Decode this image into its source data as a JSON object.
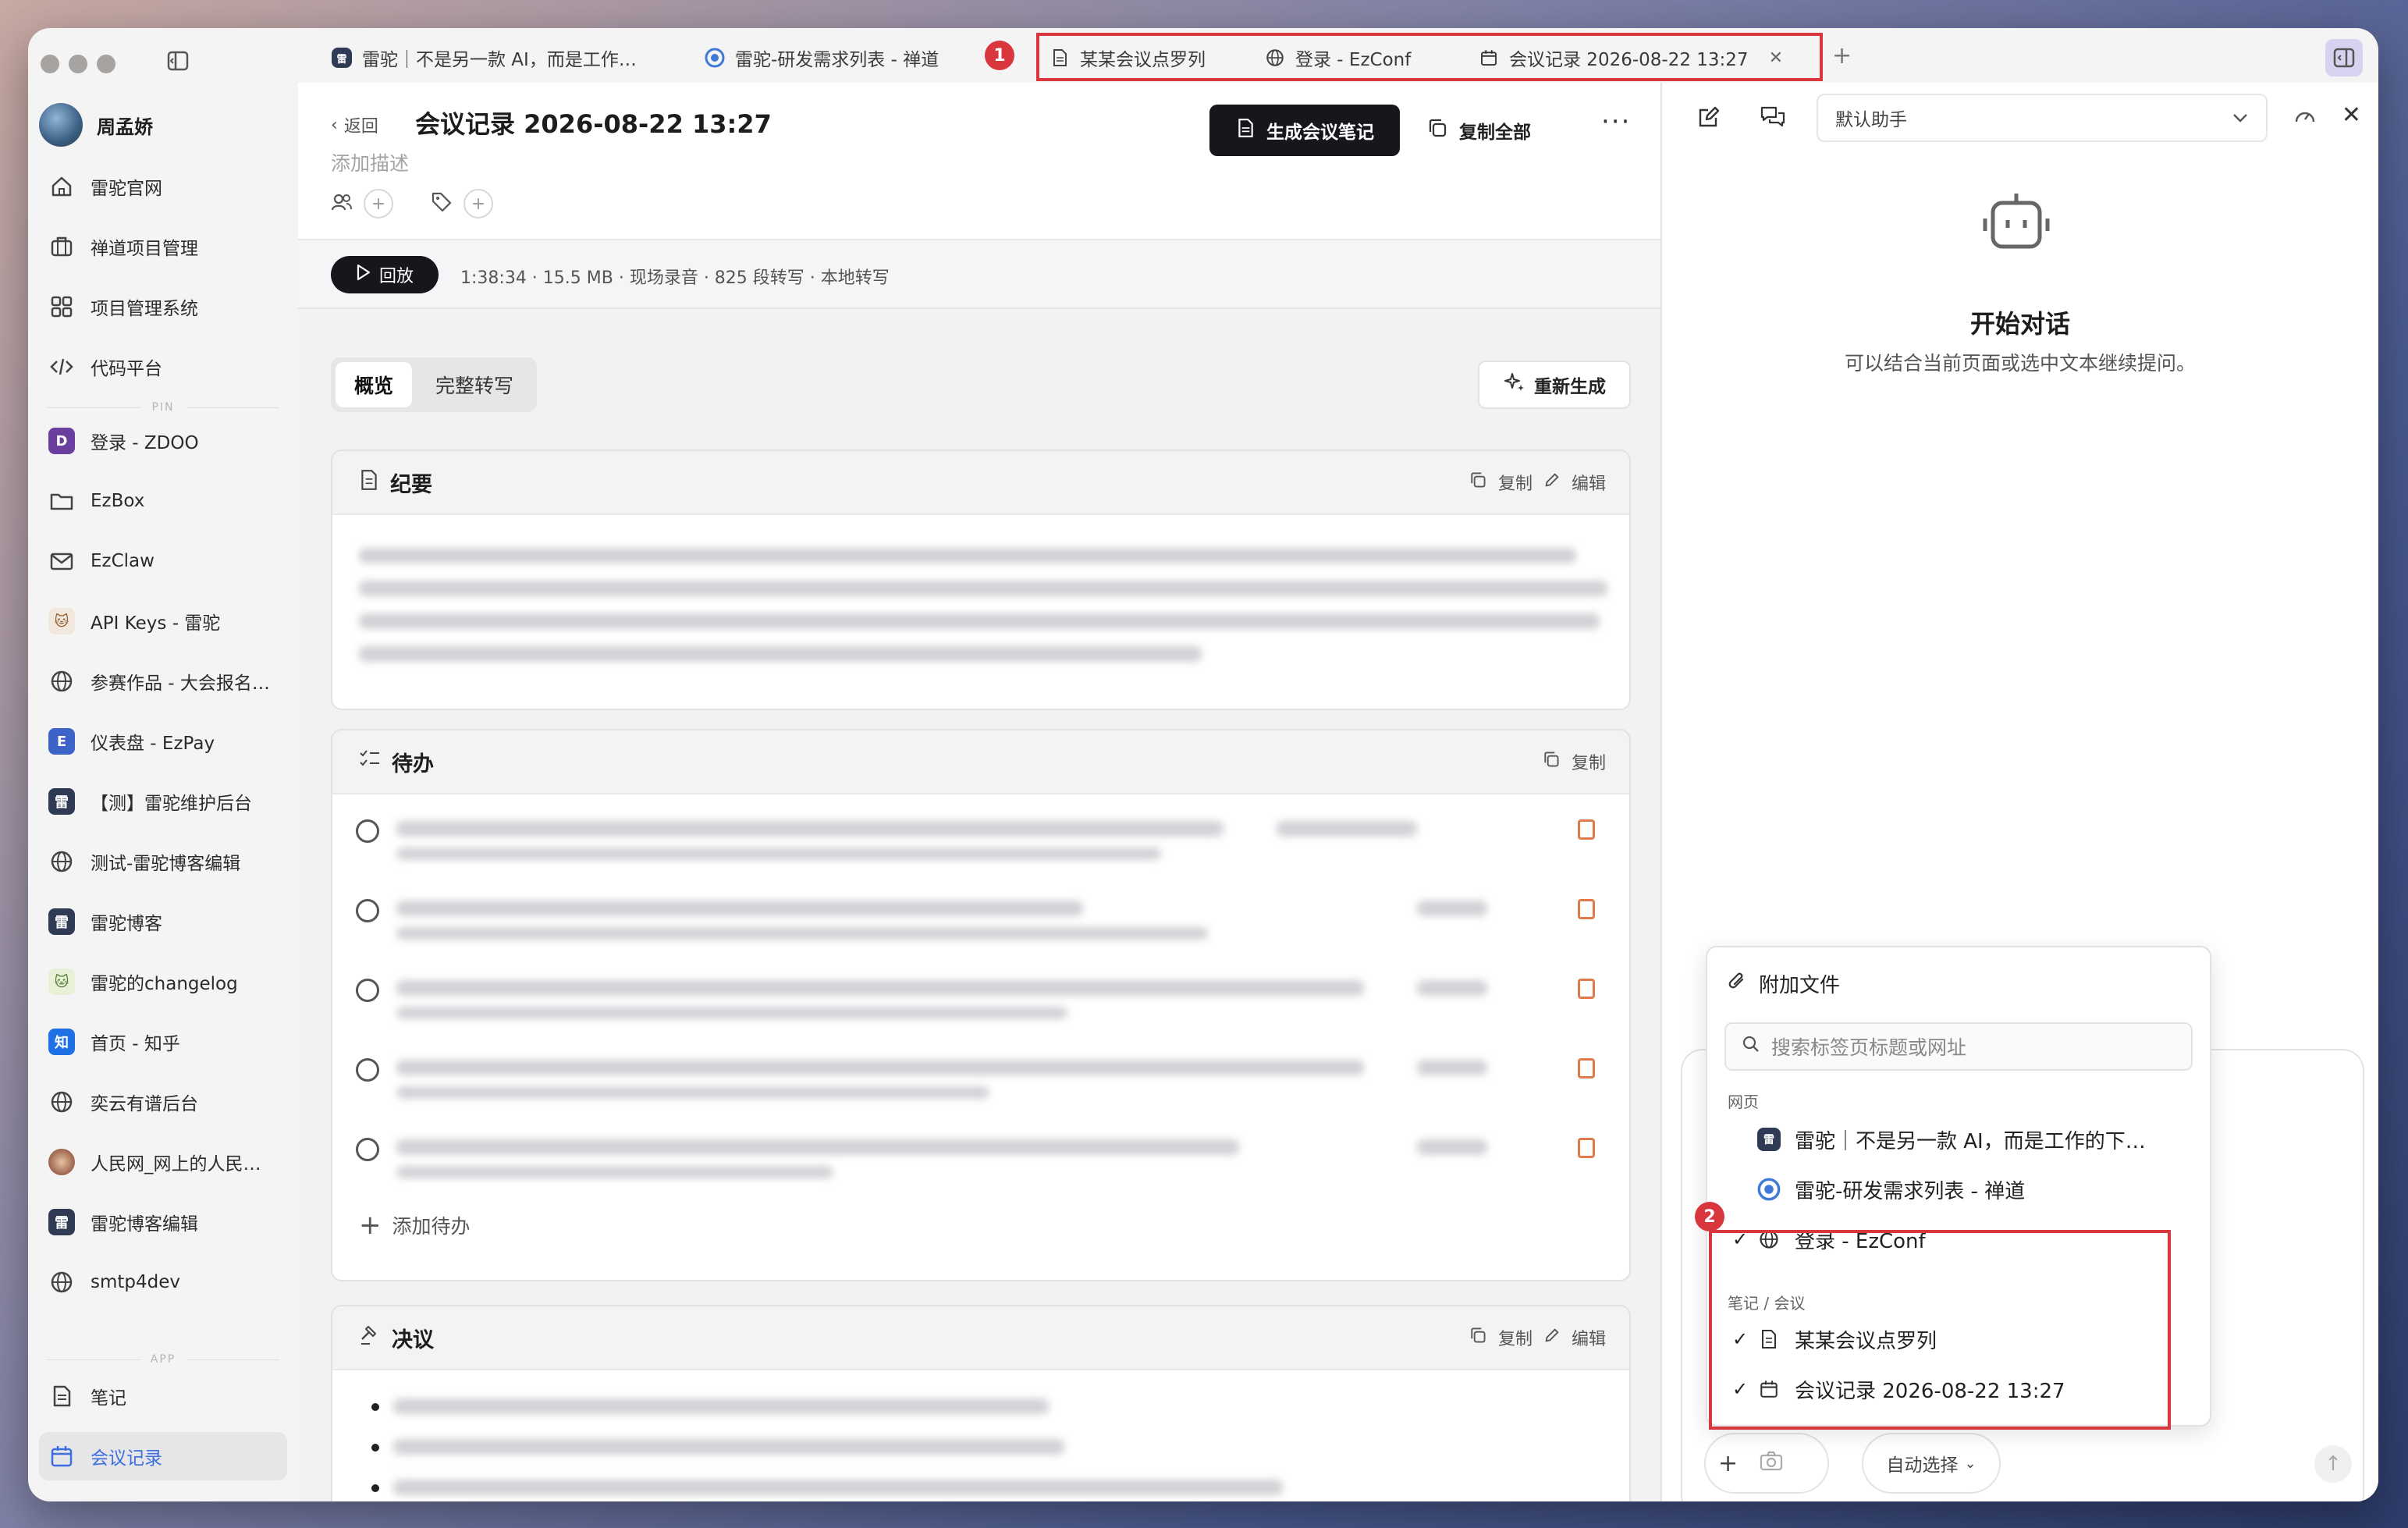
{
  "sidebar": {
    "user_name": "周孟娇",
    "items": [
      {
        "label": "雷驼官网",
        "icon": "home-icon"
      },
      {
        "label": "禅道项目管理",
        "icon": "briefcase-icon"
      },
      {
        "label": "项目管理系统",
        "icon": "grid-icon"
      },
      {
        "label": "代码平台",
        "icon": "code-icon"
      }
    ],
    "pin_label": "PIN",
    "pinned": [
      {
        "label": "登录 - ZDOO",
        "icon": "zdoo-logo-icon"
      },
      {
        "label": "EzBox",
        "icon": "folder-icon"
      },
      {
        "label": "EzClaw",
        "icon": "mail-icon"
      },
      {
        "label": "API Keys - 雷驼",
        "icon": "cat-logo-icon"
      },
      {
        "label": "参赛作品 - 大会报名…",
        "icon": "globe-icon"
      },
      {
        "label": "仪表盘 - EzPay",
        "icon": "ezpay-logo-icon"
      },
      {
        "label": "【测】雷驼维护后台",
        "icon": "app-logo-icon"
      },
      {
        "label": "测试-雷驼博客编辑",
        "icon": "globe-icon"
      },
      {
        "label": "雷驼博客",
        "icon": "app-logo-icon"
      },
      {
        "label": "雷驼的changelog",
        "icon": "cat-logo-icon"
      },
      {
        "label": "首页 - 知乎",
        "icon": "zhihu-logo-icon"
      },
      {
        "label": "奕云有谱后台",
        "icon": "globe-icon"
      },
      {
        "label": "人民网_网上的人民…",
        "icon": "people-logo-icon"
      },
      {
        "label": "雷驼博客编辑",
        "icon": "app-logo-icon"
      },
      {
        "label": "smtp4dev",
        "icon": "globe-icon"
      }
    ],
    "app_label": "APP",
    "app_items": [
      {
        "label": "笔记",
        "icon": "note-icon"
      },
      {
        "label": "会议记录",
        "icon": "calendar-icon"
      }
    ]
  },
  "tabs": [
    {
      "label": "雷驼｜不是另一款 AI，而是工作…"
    },
    {
      "label": "雷驼-研发需求列表 - 禅道"
    },
    {
      "label": "某某会议点罗列"
    },
    {
      "label": "登录 - EzConf"
    },
    {
      "label": "会议记录 2026-08-22 13:27"
    }
  ],
  "annotations": {
    "badge1": "1",
    "badge2": "2"
  },
  "header": {
    "back_label": "返回",
    "title": "会议记录 2026-08-22 13:27",
    "add_description": "添加描述",
    "generate_notes_label": "生成会议笔记",
    "copy_all_label": "复制全部",
    "more_label": "···"
  },
  "playback": {
    "play_label": "回放",
    "meta": "1:38:34 · 15.5 MB · 现场录音 · 825 段转写 · 本地转写"
  },
  "view_tabs": [
    "概览",
    "完整转写"
  ],
  "regenerate_label": "重新生成",
  "sections": {
    "summary": {
      "title": "纪要",
      "copy": "复制",
      "edit": "编辑"
    },
    "todos": {
      "title": "待办",
      "copy": "复制",
      "add_label": "添加待办"
    },
    "decisions": {
      "title": "决议",
      "copy": "复制",
      "edit": "编辑"
    }
  },
  "assistant": {
    "selector_value": "默认助手",
    "start_title": "开始对话",
    "start_subtitle": "可以结合当前页面或选中文本继续提问。",
    "auto_select_label": "自动选择"
  },
  "attach_popup": {
    "title": "附加文件",
    "search_placeholder": "搜索标签页标题或网址",
    "web_section": "网页",
    "web_items": [
      {
        "label": "雷驼｜不是另一款 AI，而是工作的下…",
        "checked": false
      },
      {
        "label": "雷驼-研发需求列表 - 禅道",
        "checked": false
      },
      {
        "label": "登录 - EzConf",
        "checked": true
      }
    ],
    "notes_section": "笔记 / 会议",
    "note_items": [
      {
        "label": "某某会议点罗列",
        "checked": true
      },
      {
        "label": "会议记录 2026-08-22 13:27",
        "checked": true
      }
    ],
    "check_mark": "✓"
  }
}
